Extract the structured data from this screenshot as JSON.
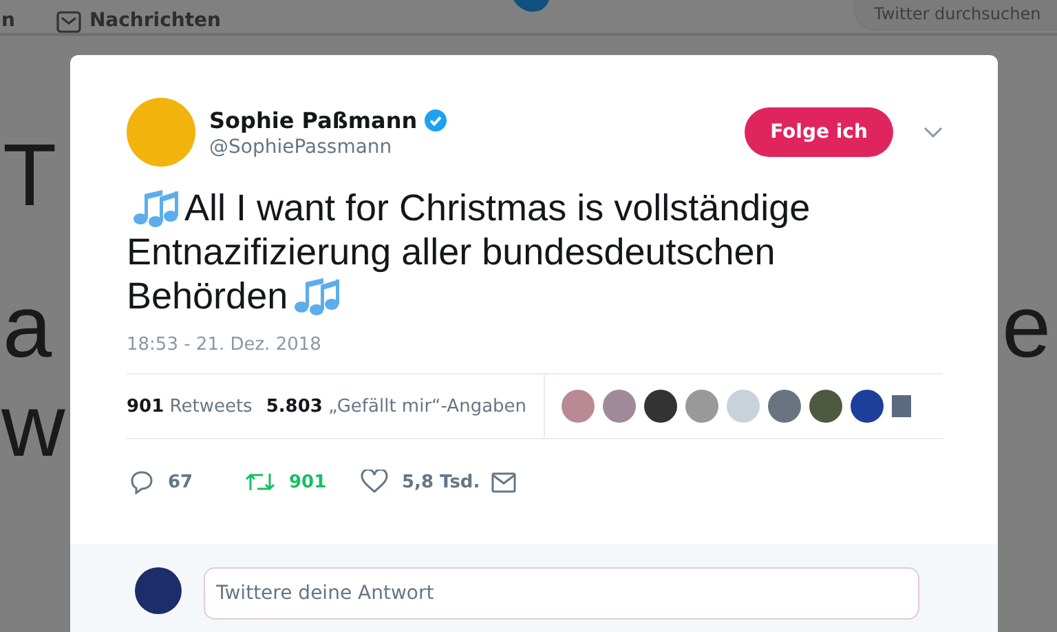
{
  "top_bar": {
    "cut_left": "n",
    "messages": "Nachrichten",
    "search": {
      "placeholder": "Twitter durchsuchen"
    }
  },
  "background_fragments": [
    "T",
    "a",
    "e",
    "w"
  ],
  "tweet": {
    "author": {
      "name": "Sophie Paßmann",
      "handle": "@SophiePassmann",
      "verified": true
    },
    "follow_button": "Folge ich",
    "text_lines": [
      "All I want for Christmas is vollständige",
      "Entnazifizierung aller bundesdeutschen",
      "Behörden"
    ],
    "timestamp": "18:53 - 21. Dez. 2018",
    "stats": [
      {
        "count": "901",
        "label": "Retweets"
      },
      {
        "count": "5.803",
        "label": "„Gefällt mir“-Angaben"
      }
    ],
    "actions": [
      {
        "kind": "reply",
        "count": "67",
        "selected": false
      },
      {
        "kind": "retweet",
        "count": "901",
        "selected": true
      },
      {
        "kind": "like",
        "count": "5,8 Tsd.",
        "selected": false
      },
      {
        "kind": "message"
      }
    ]
  },
  "reply": {
    "placeholder": "Twittere deine Antwort"
  }
}
